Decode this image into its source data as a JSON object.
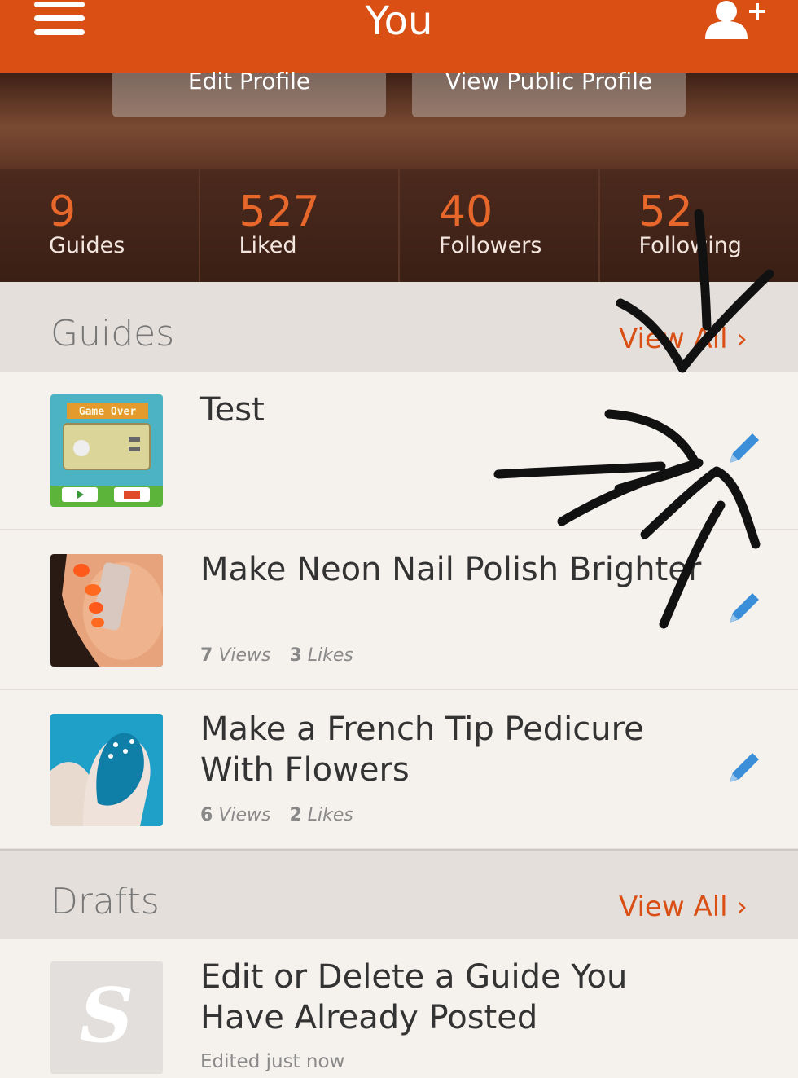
{
  "header": {
    "title": "You"
  },
  "profile_buttons": {
    "edit": "Edit Profile",
    "public": "View Public Profile"
  },
  "stats": [
    {
      "value": "9",
      "label": "Guides"
    },
    {
      "value": "527",
      "label": "Liked"
    },
    {
      "value": "40",
      "label": "Followers"
    },
    {
      "value": "52",
      "label": "Following"
    }
  ],
  "guides": {
    "title": "Guides",
    "view_all": "View All ›",
    "items": [
      {
        "title": "Test",
        "views_count": "",
        "views_label": "",
        "likes_count": "",
        "likes_label": ""
      },
      {
        "title": "Make Neon Nail Polish Brighter",
        "views_count": "7",
        "views_label": "Views",
        "likes_count": "3",
        "likes_label": "Likes"
      },
      {
        "title": "Make a French Tip Pedicure With Flowers",
        "views_count": "6",
        "views_label": "Views",
        "likes_count": "2",
        "likes_label": "Likes"
      }
    ]
  },
  "thumb_text": {
    "game_over": "Game Over"
  },
  "drafts": {
    "title": "Drafts",
    "view_all": "View All ›",
    "items": [
      {
        "title": "Edit or Delete a Guide You Have Already Posted",
        "meta": "Edited just now",
        "thumb_letter": "S"
      }
    ]
  },
  "colors": {
    "brand": "#d94f14",
    "edit_icon": "#3b8fd9",
    "background": "#f5f1ed"
  },
  "icons": {
    "menu": "hamburger-icon",
    "add_user": "add-user-icon",
    "edit": "pencil-icon"
  }
}
